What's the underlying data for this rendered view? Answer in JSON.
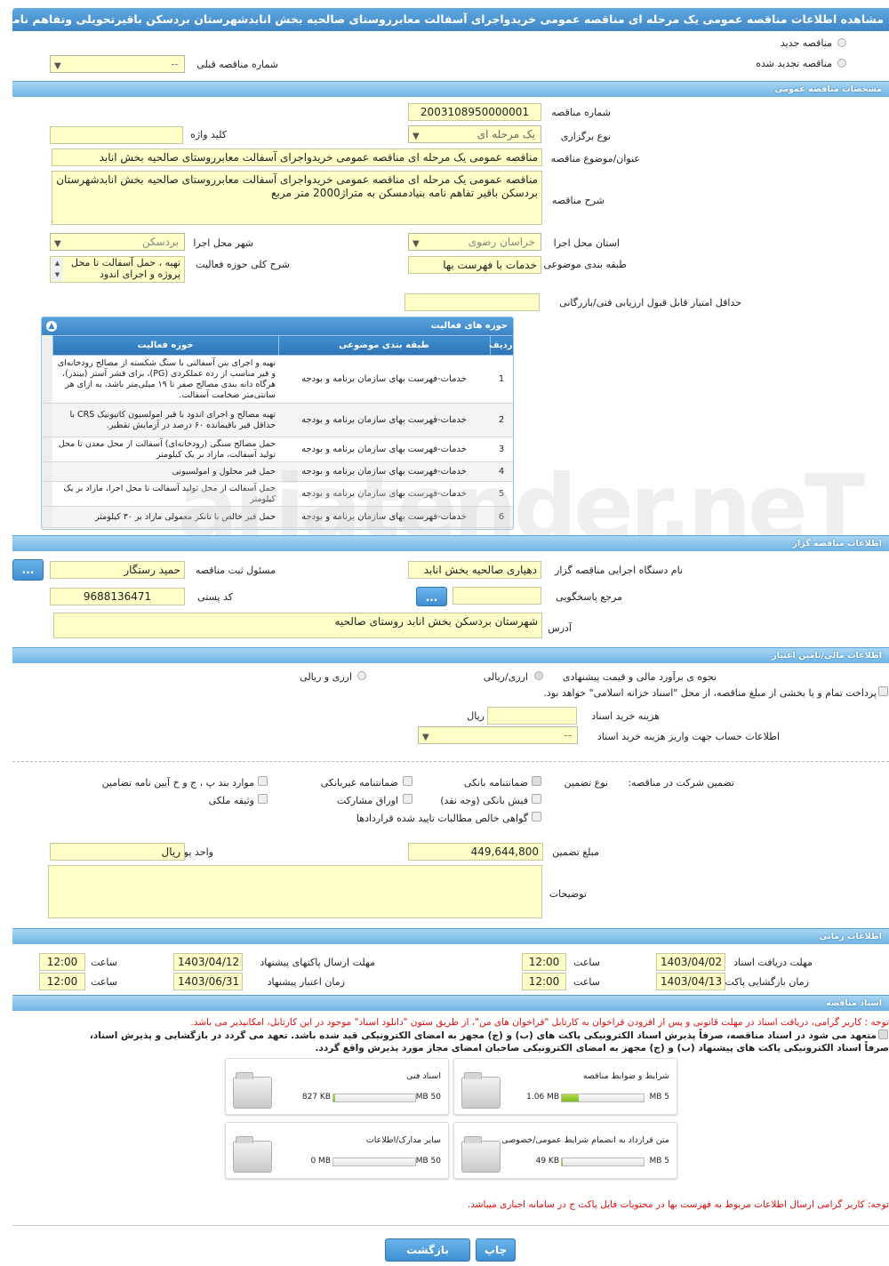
{
  "title": "مشاهده اطلاعات مناقصه عمومی یک مرحله ای مناقصه عمومی خریدواجرای آسفالت معابرروستای صالحیه بخش انابدشهرستان بردسکن باقیرتحویلی وتفاهم نامه بنیادم",
  "top": {
    "new_label": "مناقصه جدید",
    "renew_label": "مناقصه تجدید شده",
    "prev_label": "شماره مناقصه قبلی",
    "prev_value": "--"
  },
  "sections": {
    "general": "مشخصات مناقصه عمومی",
    "org": "اطلاعات مناقصه گزار",
    "finance": "اطلاعات مالی/تامین اعتبار",
    "time": "اطلاعات زمانی",
    "docs": "اسناد مناقصه"
  },
  "general": {
    "number_label": "شماره مناقصه",
    "number_value": "2003108950000001",
    "type_label": "نوع برگزاری",
    "type_value": "یک مرحله ای",
    "keyword_label": "کلید واژه",
    "keyword_value": "",
    "subject_label": "عنوان/موضوع مناقصه",
    "subject_value": "مناقصه عمومی یک مرحله ای مناقصه عمومی خریدواجرای  آسفالت معابرروستای صالحیه بخش انابد",
    "desc_label": "شرح مناقصه",
    "desc_value": "مناقصه عمومی یک مرحله ای مناقصه عمومی خریدواجرای  آسفالت معابرروستای صالحیه بخش انابدشهرستان بردسکن باقیر تفاهم نامه بنیادمسکن به متراژ2000 متر مربع",
    "province_label": "استان محل اجرا",
    "province_value": "خراسان رضوی",
    "city_label": "شهر محل اجرا",
    "city_value": "بردسکن",
    "category_label": "طبقه بندی موضوعی",
    "category_value": "خدمات با فهرست بها",
    "scope_label": "شرح کلی حوزه فعالیت",
    "scope_value": "تهیه ، حمل آسفالت تا محل پروژه و اجرای اندود",
    "minscore_label": "حداقل امتیاز قابل قبول ارزیابی فنی/بازرگانی",
    "minscore_value": ""
  },
  "activity": {
    "title": "حوزه های فعالیت",
    "headers": [
      "ردیف",
      "طبقه بندی موضوعی",
      "حوزه فعالیت"
    ],
    "rows": [
      [
        "1",
        "خدمات-فهرست بهای سازمان برنامه و بودجه",
        "تهیه و اجرای بتن آسفالتی با سنگ شکسته از مصالح رودخانه‌ای و قیر مناسب از رده عملکردی (PG)، برای قشر آستر (بیندر)، هرگاه دانه بندی مصالح صفر تا ۱۹ میلی‌متر باشد، به ازای هر سانتی‌متر ضخامت آسفالت."
      ],
      [
        "2",
        "خدمات-فهرست بهای سازمان برنامه و بودجه",
        "تهیه مصالح و اجرای اندود با قیر امولسیون کاتیونیک CRS با حداقل قیر باقیمانده ۶۰ درصد در آزمایش تقطیر."
      ],
      [
        "3",
        "خدمات-فهرست بهای سازمان برنامه و بودجه",
        "حمل مصالح سنگی (رودخانه‌ای) آسفالت از محل معدن تا محل تولید آسفالت، مازاد بر یک کیلومتر"
      ],
      [
        "4",
        "خدمات-فهرست بهای سازمان برنامه و بودجه",
        "حمل قیر محلول و امولسیونی"
      ],
      [
        "5",
        "خدمات-فهرست بهای سازمان برنامه و بودجه",
        "حمل آسفالت از محل تولید آسفالت تا محل اجرا، مازاد بر یک کیلومتر"
      ],
      [
        "6",
        "خدمات-فهرست بهای سازمان برنامه و بودجه",
        "حمل قیر خالص با تانکر معمولی مازاد بر ۳۰ کیلومتر"
      ]
    ]
  },
  "org": {
    "executor_label": "نام دستگاه اجرایی مناقصه گزار",
    "executor_value": "دهیاری صالحیه بخش انابد",
    "responsible_label": "مسئول ثبت مناقصه",
    "responsible_value": "حمید رستگار",
    "ref_label": "مرجع پاسخگویی",
    "ref_value": "",
    "postal_label": "کد پستی",
    "postal_value": "9688136471",
    "address_label": "آدرس",
    "address_value": "شهرستان بردسکن بخش انابد روستای صالحیه",
    "dots": "..."
  },
  "finance": {
    "method_label": "نحوه ی برآورد مالی و قیمت پیشنهادی",
    "opt1": "ارزی/ریالی",
    "opt2": "ارزی و ریالی",
    "treasury": "پرداخت تمام و یا بخشی از مبلغ مناقصه، از محل \"اسناد خزانه اسلامی\" خواهد بود.",
    "doccost_label": "هزینه خرید اسناد",
    "doccost_value": "",
    "doccost_unit": "ریال",
    "account_label": "اطلاعات حساب جهت واریز هزینه خرید اسناد",
    "account_value": "--",
    "guarantee_label": "تضمین شرکت در مناقصه:",
    "gtype_label": "نوع تضمین",
    "g_bank": "ضمانتنامه بانکی",
    "g_nonbank": "ضمانتنامه غیربانکی",
    "g_items": "موارد بند پ ، ج و خ آیین نامه تضامین",
    "g_cash": "فیش بانکی (وجه نقد)",
    "g_bonds": "اوراق مشارکت",
    "g_property": "وثیقه ملکی",
    "g_claims": "گواهی خالص مطالبات تایید شده قراردادها",
    "amount_label": "مبلغ تضمین",
    "amount_value": "449,644,800",
    "currency_label": "واحد پول",
    "currency_value": "ریال",
    "notes_label": "توضیحات",
    "notes_value": ""
  },
  "time": {
    "receive_label": "مهلت دریافت اسناد",
    "receive_date": "1403/04/02",
    "receive_time": "12:00",
    "send_label": "مهلت ارسال پاکتهای پیشنهاد",
    "send_date": "1403/04/12",
    "send_time": "12:00",
    "open_label": "زمان بازگشایی پاکت ها",
    "open_date": "1403/04/13",
    "open_time": "12:00",
    "valid_label": "زمان اعتبار پیشنهاد",
    "valid_date": "1403/06/31",
    "valid_time": "12:00",
    "time_label": "ساعت"
  },
  "docs": {
    "note1": "توجه : کاربر گرامی، دریافت اسناد در مهلت قانونی و پس از افزودن فراخوان به کارتابل \"فراخوان های من\"، از طریق ستون \"دانلود اسناد\" موجود در این کارتابل، امکانپذیر می باشد.",
    "commit1": "متعهد می شود در اسناد مناقصه، صرفاً پذیرش اسناد الکترونیکی پاکت های (ب) و (ج) مجهز به امضای الکترونیکی قید شده باشد. تعهد می گردد در بازگشایی و پذیرش اسناد،",
    "commit2": "صرفاً اسناد الکترونیکی پاکت های پیشنهاد (ب) و (ج) مجهز به امضای الکترونیکی صاحبان امضای مجاز مورد پذیرش واقع گردد.",
    "files": [
      {
        "name": "شرایط و ضوابط مناقصه",
        "size": "1.06 MB",
        "max": "5 MB",
        "fill": 0.21
      },
      {
        "name": "اسناد فنی",
        "size": "827 KB",
        "max": "50 MB",
        "fill": 0.02
      },
      {
        "name": "متن قرارداد به انضمام شرایط عمومی/خصوصی",
        "size": "49 KB",
        "max": "5 MB",
        "fill": 0.01
      },
      {
        "name": "سایر مدارک/اطلاعات",
        "size": "0 MB",
        "max": "50 MB",
        "fill": 0
      }
    ],
    "note2": "توجه: کاربر گرامی ارسال اطلاعات مربوط به فهرست بها در محتویات فایل پاکت ج در سامانه اجباری میباشد."
  },
  "buttons": {
    "print": "چاپ",
    "back": "بازگشت"
  },
  "watermark": "ariatender.neT",
  "colors": {
    "header": "#3f86c7",
    "field": "#ffffc8",
    "progress": "#8cc63f",
    "note": "#e01010"
  }
}
